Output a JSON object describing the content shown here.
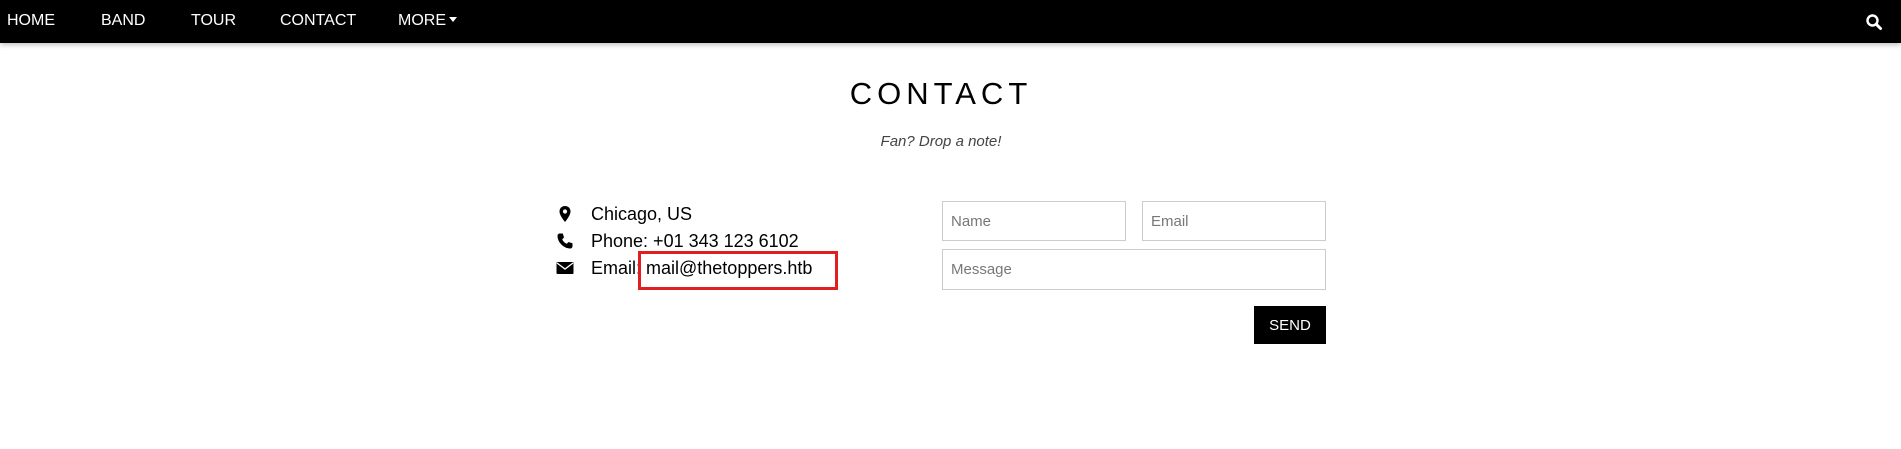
{
  "nav": {
    "items": [
      "HOME",
      "BAND",
      "TOUR",
      "CONTACT"
    ],
    "more_label": "MORE",
    "search_icon": "search-icon"
  },
  "section": {
    "title": "CONTACT",
    "subtitle": "Fan? Drop a note!"
  },
  "contact_info": {
    "location": "Chicago, US",
    "phone": "Phone: +01 343 123 6102",
    "email": "Email: mail@thetoppers.htb",
    "icons": [
      "map-marker-icon",
      "phone-icon",
      "envelope-icon"
    ]
  },
  "form": {
    "name_placeholder": "Name",
    "email_placeholder": "Email",
    "message_placeholder": "Message",
    "send_label": "SEND"
  },
  "colors": {
    "navbar": "#000000",
    "highlight": "#e02020",
    "button": "#000000"
  }
}
